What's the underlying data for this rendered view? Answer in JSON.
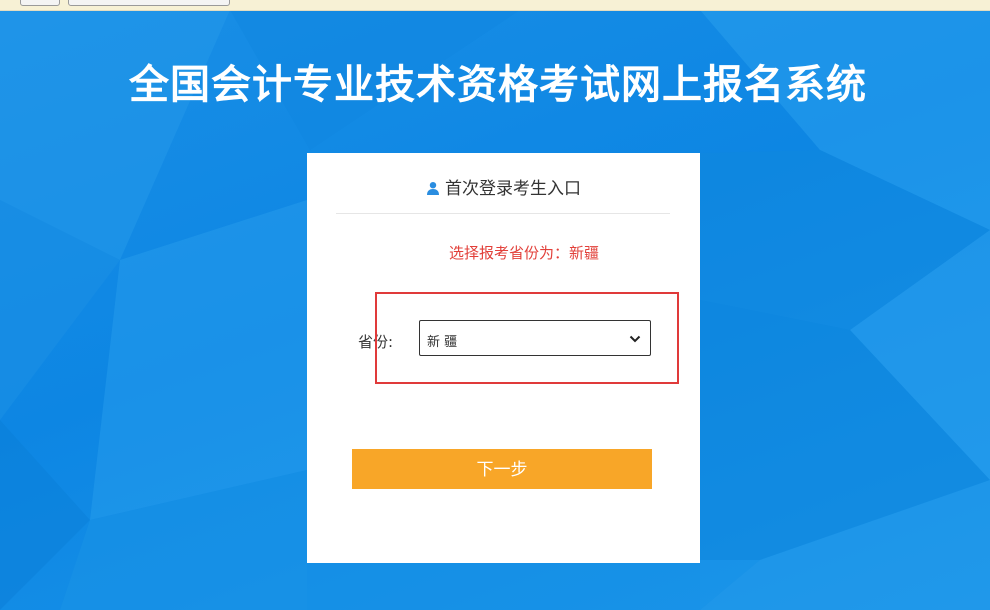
{
  "site": {
    "title": "全国会计专业技术资格考试网上报名系统"
  },
  "login_card": {
    "header": "首次登录考生入口",
    "header_icon": "user-icon",
    "notice": "选择报考省份为：新疆",
    "province_label": "省份:",
    "province_value": "新 疆",
    "next_button": "下一步"
  },
  "colors": {
    "background": "#0d86e3",
    "notice": "#e2403a",
    "next_button": "#f8a628",
    "highlight_border": "#e03a3a"
  }
}
